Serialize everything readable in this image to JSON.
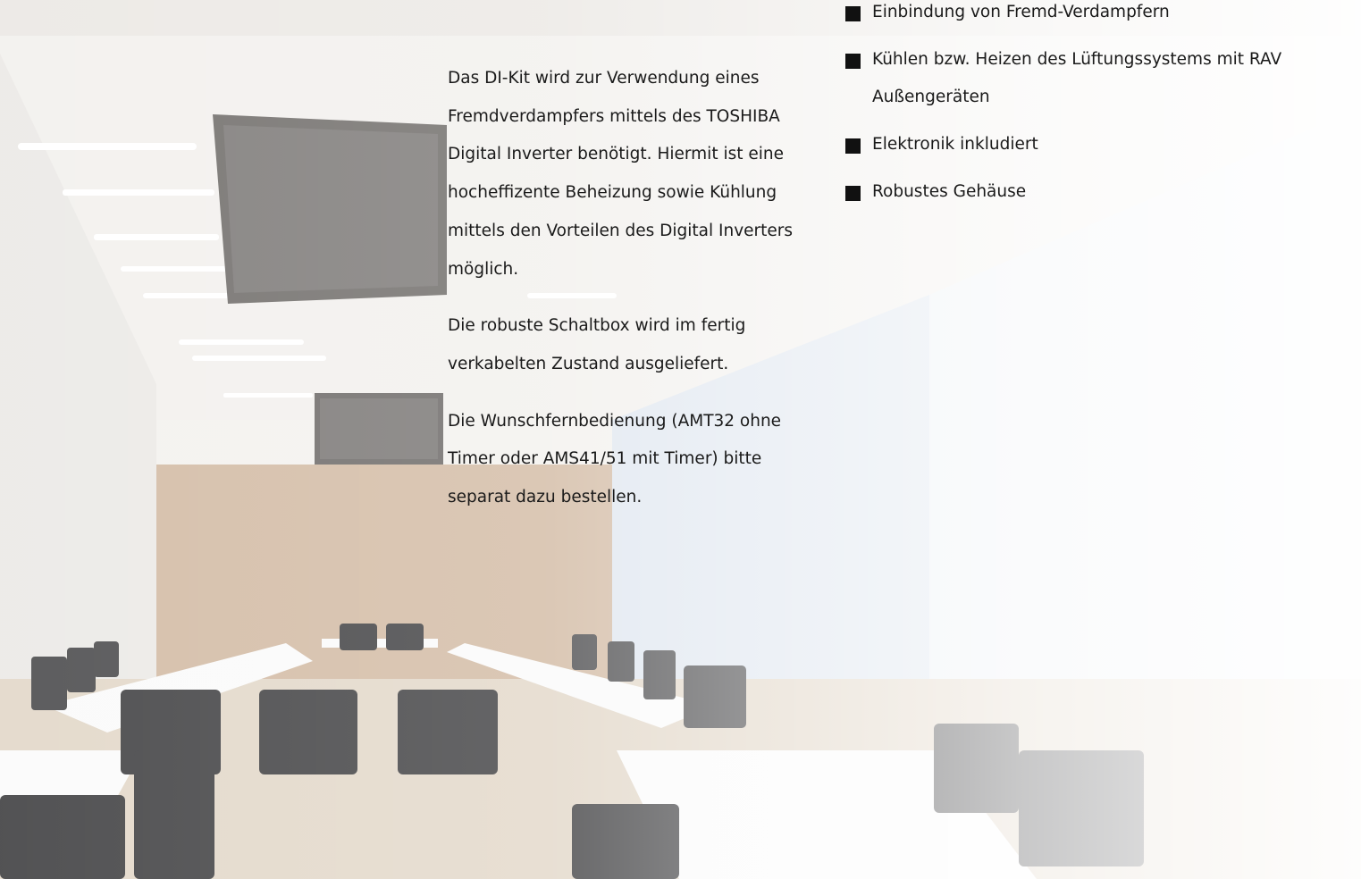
{
  "description": {
    "paragraphs": [
      "Das DI-Kit wird zur Verwendung eines Fremdverdampfers mittels des TOSHIBA Digital Inverter benötigt. Hiermit ist eine hocheffizente Beheizung sowie Kühlung mittels den Vorteilen des Digital Inverters möglich.",
      "Die robuste Schaltbox wird im fertig verkabelten Zustand ausgeliefert.",
      "Die Wunschfernbedienung (AMT32 ohne Timer oder AMS41/51 mit Timer) bitte separat dazu bestellen."
    ]
  },
  "features": {
    "bullet_icon": "black-square-bullet",
    "items": [
      "Einbindung von Fremd-Verdampfern",
      "Kühlen bzw. Heizen des Lüftungssystems mit RAV Außengeräten",
      "Elektronik inkludiert",
      "Robustes Gehäuse"
    ]
  },
  "background": {
    "subject": "conference-room-photo",
    "tint": "#ffffff"
  }
}
